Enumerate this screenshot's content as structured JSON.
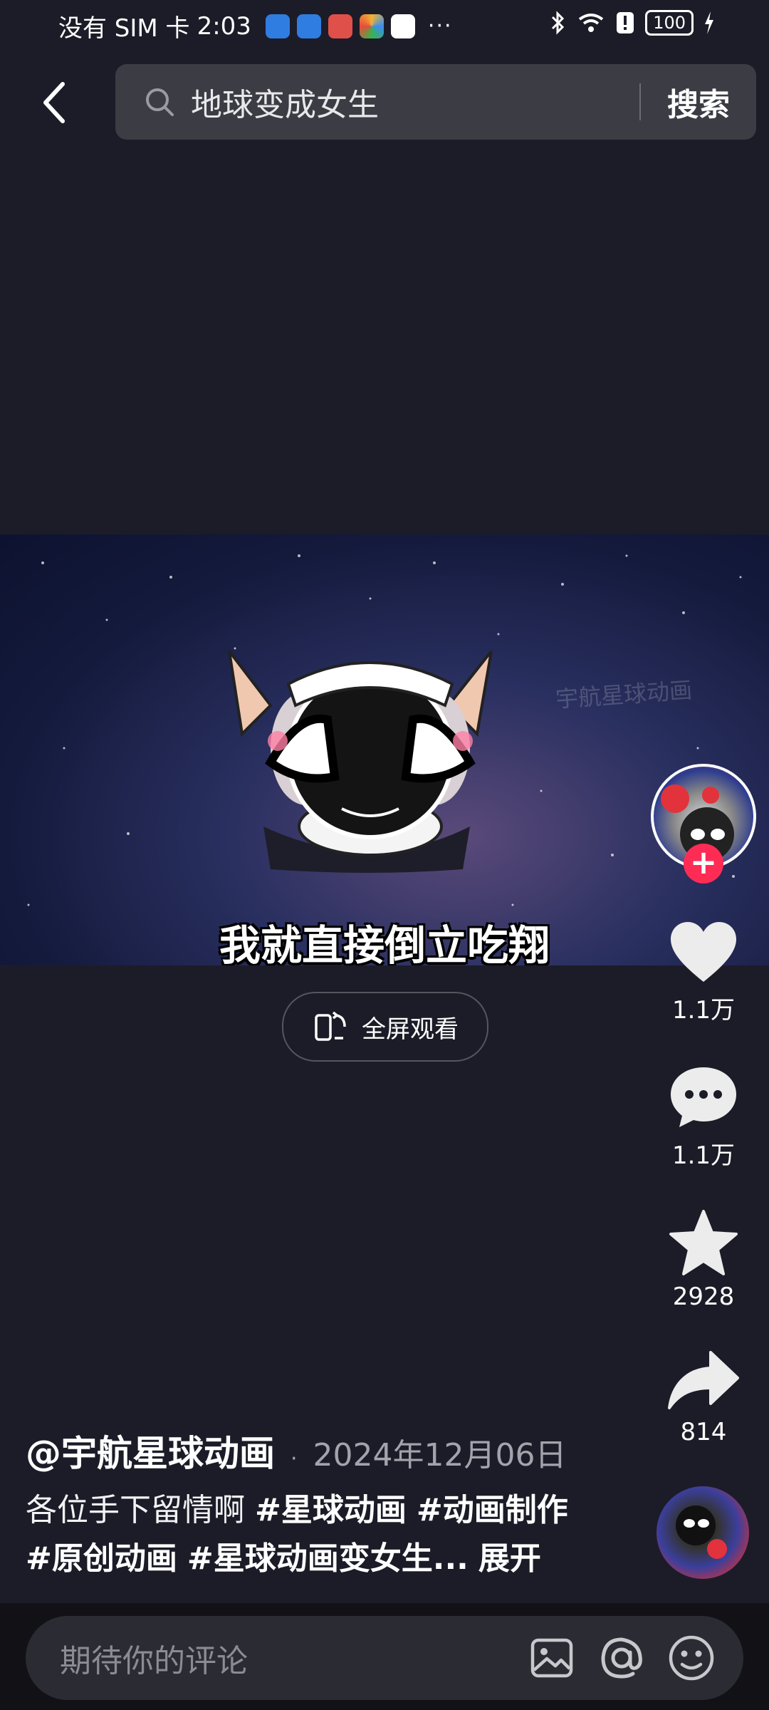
{
  "status_bar": {
    "carrier": "没有 SIM 卡",
    "time": "2:03",
    "more": "···",
    "battery": "100"
  },
  "header": {
    "search_query": "地球变成女生",
    "search_button": "搜索"
  },
  "video": {
    "subtitle": "我就直接倒立吃翔",
    "watermark": "宇航星球动画",
    "fullscreen_label": "全屏观看"
  },
  "actions": {
    "likes": "1.1万",
    "comments": "1.1万",
    "favorites": "2928",
    "shares": "814"
  },
  "post": {
    "author": "@宇航星球动画",
    "date": "2024年12月06日",
    "caption_text": "各位手下留情啊",
    "tags": [
      "#星球动画",
      "#动画制作",
      "#原创动画",
      "#星球动画变女生..."
    ],
    "expand": "展开"
  },
  "comment_bar": {
    "placeholder": "期待你的评论"
  },
  "colors": {
    "background": "#1c1c28",
    "follow_accent": "#fe2c55",
    "search_bg": "#3b3c44"
  }
}
